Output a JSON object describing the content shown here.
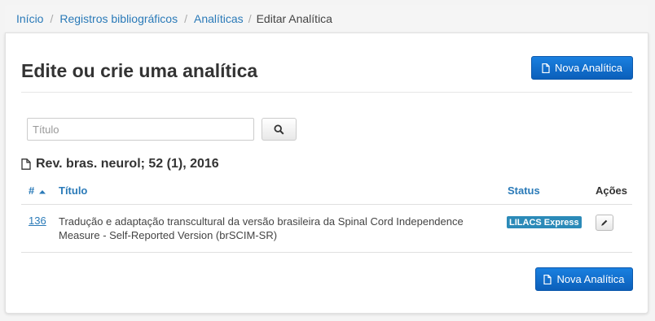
{
  "breadcrumb": {
    "items": [
      "Início",
      "Registros bibliográficos",
      "Analíticas"
    ],
    "separator": "/",
    "current": "Editar Analítica"
  },
  "page": {
    "title": "Edite ou crie uma analítica",
    "new_button_label": "Nova Analítica"
  },
  "search": {
    "placeholder": "Título",
    "value": "",
    "button_icon": "search-icon"
  },
  "section": {
    "title": "Rev. bras. neurol; 52 (1), 2016",
    "icon": "file-icon"
  },
  "table": {
    "columns": {
      "id": "#",
      "title": "Título",
      "status": "Status",
      "actions": "Ações"
    },
    "sort_indicator": "caret-up-icon",
    "rows": [
      {
        "id": "136",
        "title": "Tradução e adaptação transcultural da versão brasileira da Spinal Cord Independence Measure - Self-Reported Version (brSCIM-SR)",
        "status": "LILACS Express",
        "action_icon": "pencil-icon"
      }
    ]
  },
  "colors": {
    "link": "#2a7ab8",
    "primary": "#0f6fd0",
    "badge": "#2b8ab8"
  }
}
